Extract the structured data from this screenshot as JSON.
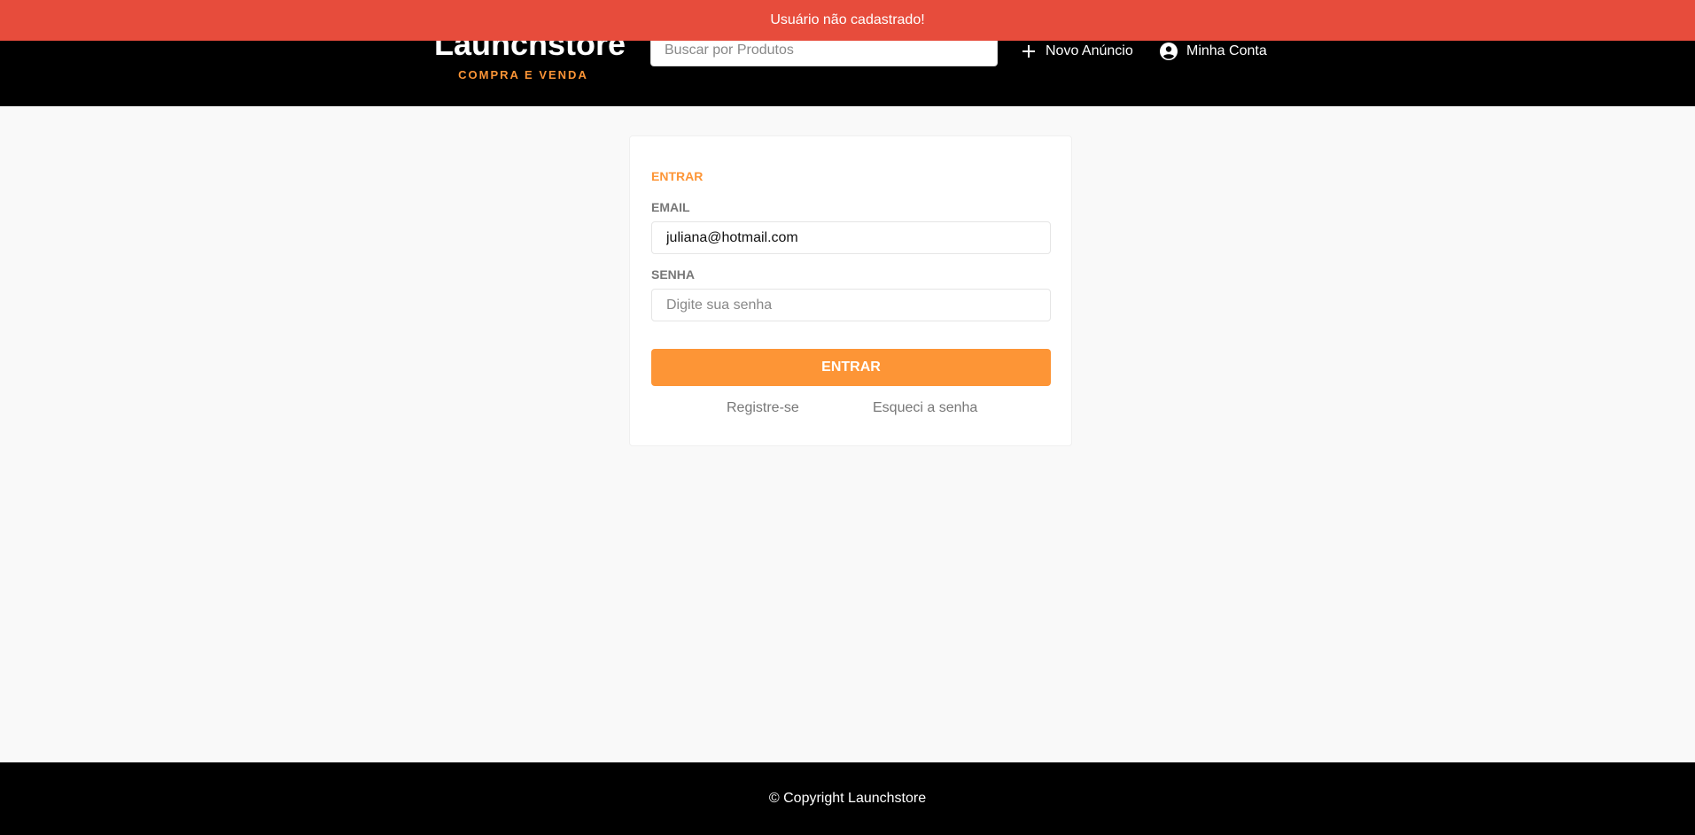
{
  "header": {
    "logo_title": "Launchstore",
    "logo_subtitle": "COMPRA E VENDA",
    "search_placeholder": "Buscar por Produtos",
    "nav": {
      "new_ad_label": "Novo Anúncio",
      "new_ad_icon": "plus-icon",
      "account_label": "Minha Conta",
      "account_icon": "account-circle-icon"
    }
  },
  "toast": {
    "message": "Usuário não cadastrado!",
    "color": "#e74c3c"
  },
  "login_form": {
    "title": "ENTRAR",
    "email_label": "EMAIL",
    "email_value": "juliana@hotmail.com",
    "password_label": "SENHA",
    "password_placeholder": "Digite sua senha",
    "submit_label": "ENTRAR",
    "register_link": "Registre-se",
    "forgot_link": "Esqueci a senha"
  },
  "footer": {
    "copyright": "© Copyright Launchstore"
  },
  "colors": {
    "accent": "#fd9536",
    "header_bg": "#000000",
    "page_bg": "#f9f9f9"
  }
}
